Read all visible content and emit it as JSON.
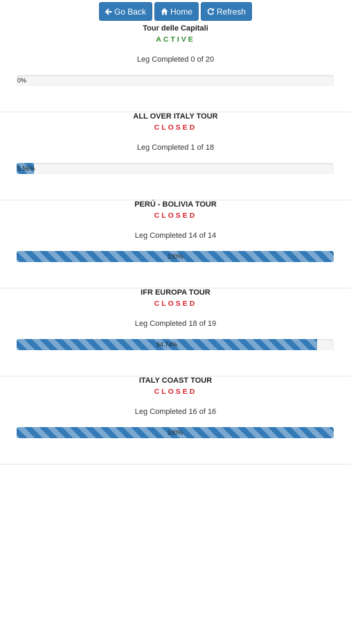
{
  "toolbar": {
    "go_back": "Go Back",
    "home": "Home",
    "refresh": "Refresh"
  },
  "colors": {
    "accent": "#337ab7",
    "active": "#2e8b2e",
    "closed": "#d9232d"
  },
  "tours": [
    {
      "name": "Tour delle Capitali",
      "status": "ACTIVE",
      "status_kind": "active",
      "leg_text": "Leg Completed 0 of 20",
      "percent_label": "0%",
      "progress": 0.0
    },
    {
      "name": "ALL OVER ITALY TOUR",
      "status": "CLOSED",
      "status_kind": "closed",
      "leg_text": "Leg Completed 1 of 18",
      "percent_label": "5.56%",
      "progress": 0.0556
    },
    {
      "name": "PERÚ - BOLIVIA TOUR",
      "status": "CLOSED",
      "status_kind": "closed",
      "leg_text": "Leg Completed 14 of 14",
      "percent_label": "100%",
      "progress": 1.0
    },
    {
      "name": "IFR EUROPA TOUR",
      "status": "CLOSED",
      "status_kind": "closed",
      "leg_text": "Leg Completed 18 of 19",
      "percent_label": "94.74%",
      "progress": 0.9474
    },
    {
      "name": "ITALY COAST TOUR",
      "status": "CLOSED",
      "status_kind": "closed",
      "leg_text": "Leg Completed 16 of 16",
      "percent_label": "100%",
      "progress": 1.0
    }
  ]
}
